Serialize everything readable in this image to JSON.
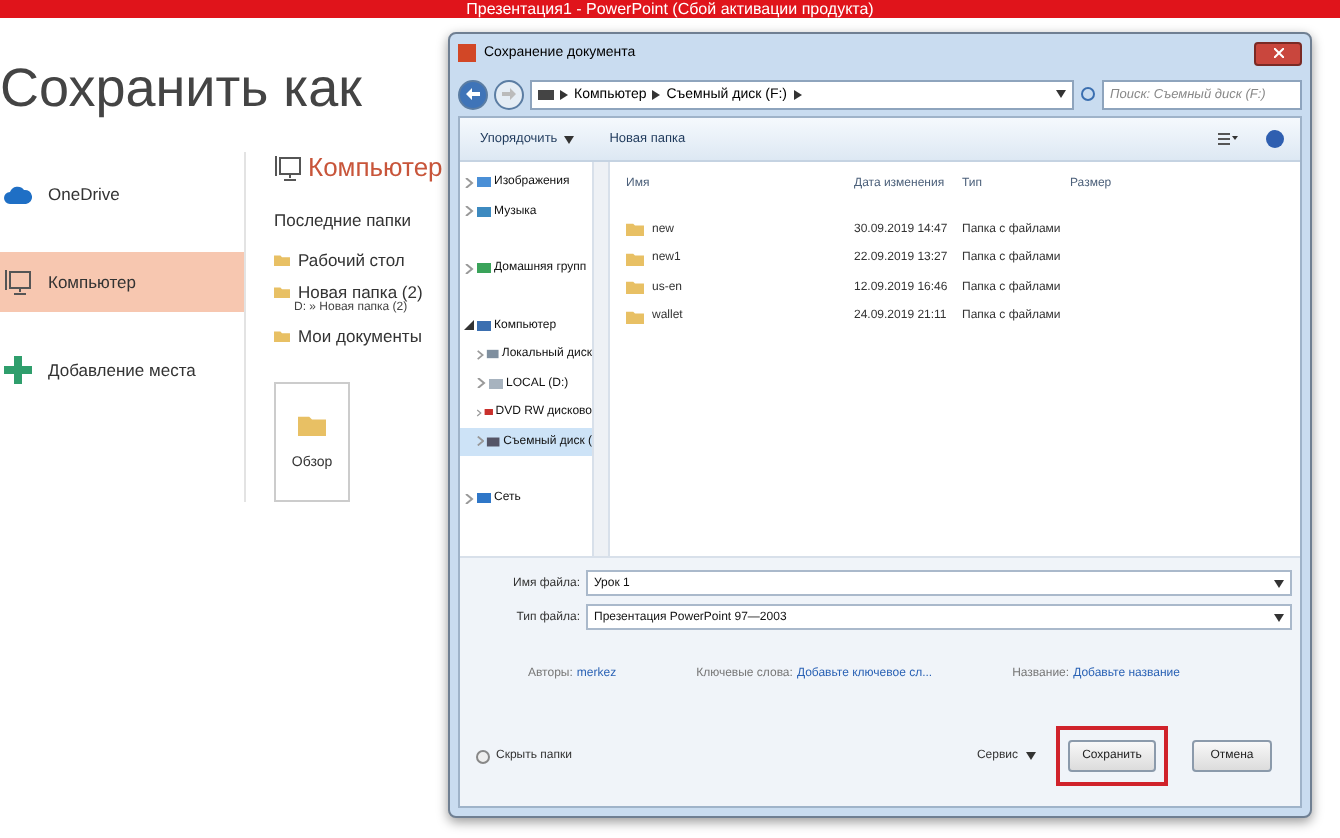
{
  "app_title": "Презентация1 - PowerPoint (Сбой активации продукта)",
  "backstage": {
    "heading": "Сохранить как",
    "places": [
      {
        "kind": "cloud",
        "label": "OneDrive",
        "selected": false
      },
      {
        "kind": "computer",
        "label": "Компьютер",
        "selected": true
      },
      {
        "kind": "add",
        "label": "Добавление места",
        "selected": false
      }
    ],
    "panel_title": "Компьютер",
    "recent_heading": "Последние папки",
    "recent": [
      {
        "name": "Рабочий стол"
      },
      {
        "name": "Новая папка (2)",
        "path": "D: » Новая папка (2)"
      },
      {
        "name": "Мои документы"
      }
    ],
    "browse": "Обзор"
  },
  "dialog": {
    "title": "Сохранение документа",
    "breadcrumb": [
      "Компьютер",
      "Съемный диск (F:)"
    ],
    "search": {
      "placeholder": "Поиск: Съемный диск (F:)"
    },
    "toolbar": {
      "organize": "Упорядочить",
      "new_folder": "Новая папка"
    },
    "nav": [
      {
        "kind": "pictures",
        "label": "Изображения",
        "expanded": false,
        "selected": false
      },
      {
        "kind": "music",
        "label": "Музыка",
        "expanded": false,
        "selected": false
      },
      {
        "kind": "homegroup",
        "label": "Домашняя групп",
        "expanded": false,
        "selected": false
      },
      {
        "kind": "computer",
        "label": "Компьютер",
        "expanded": true,
        "selected": false,
        "children": [
          {
            "kind": "localdisk",
            "label": "Локальный диск",
            "expanded": false,
            "selected": false
          },
          {
            "kind": "drive",
            "label": "LOCAL (D:)",
            "expanded": false,
            "selected": false
          },
          {
            "kind": "dvd",
            "label": "DVD RW дисково",
            "expanded": false,
            "selected": false
          },
          {
            "kind": "removable",
            "label": "Съемный диск (",
            "expanded": false,
            "selected": true
          }
        ]
      },
      {
        "kind": "network",
        "label": "Сеть",
        "expanded": false,
        "selected": false
      }
    ],
    "columns": [
      "Имя",
      "Дата изменения",
      "Тип",
      "Размер"
    ],
    "files": [
      {
        "name": "new",
        "date": "30.09.2019 14:47",
        "type": "Папка с файлами"
      },
      {
        "name": "new1",
        "date": "22.09.2019 13:27",
        "type": "Папка с файлами"
      },
      {
        "name": "us-en",
        "date": "12.09.2019 16:46",
        "type": "Папка с файлами"
      },
      {
        "name": "wallet",
        "date": "24.09.2019 21:11",
        "type": "Папка с файлами"
      }
    ],
    "file_name": {
      "label": "Имя файла:",
      "value": "Урок 1"
    },
    "file_type": {
      "label": "Тип файла:",
      "value": "Презентация PowerPoint 97—2003"
    },
    "meta": [
      {
        "label": "Авторы:",
        "value": "merkez"
      },
      {
        "label": "Ключевые слова:",
        "value": "Добавьте ключевое сл..."
      },
      {
        "label": "Название:",
        "value": "Добавьте название"
      }
    ],
    "hide_folders": "Скрыть папки",
    "tools": "Сервис",
    "buttons": [
      {
        "label": "Сохранить",
        "highlighted": true
      },
      {
        "label": "Отмена",
        "highlighted": false
      }
    ]
  }
}
